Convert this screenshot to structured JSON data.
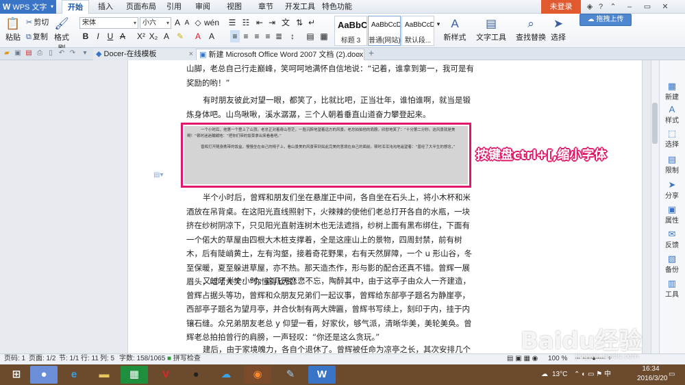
{
  "app": {
    "name": "WPS 文字",
    "menu_tabs": [
      "开始",
      "插入",
      "页面布局",
      "引用",
      "审阅",
      "视图",
      "章节",
      "开发工具",
      "特色功能"
    ],
    "active_tab": "开始",
    "login": "未登录",
    "upload": "拖拽上传"
  },
  "ribbon": {
    "paste": "粘贴",
    "cut": "剪切",
    "copy": "复制",
    "format_painter": "格式刷",
    "font_name": "宋体",
    "font_size": "小六",
    "styles": [
      {
        "sample": "AaBbC",
        "label": "标题 3"
      },
      {
        "sample": "AaBbCcD",
        "label": "普通(网站)"
      },
      {
        "sample": "AaBbCcDd",
        "label": "默认段..."
      }
    ],
    "new_style": "新样式",
    "text_tools": "文字工具",
    "find_replace": "查找替换",
    "select": "选择"
  },
  "tabs": [
    {
      "title": "Docer-在线模板"
    },
    {
      "title": "新建 Microsoft Office Word 2007 文档 (2).docx *"
    }
  ],
  "document": {
    "paragraphs": [
      "山脚，老总自己行走巅峰，笑呵呵地满怀自信地说：“记着，谁拿到第一，我可是有奖励的哟！”",
      "有时朋友彼此对望一眼，都笑了，比就比吧，正当壮年，谁怕谁啊，就当是锻炼身体吧。山鸟啾啾，溪水潺潺，三个人朝着垂直山道奋力攀登起来。",
      "半个小时后，曾辉和朋友们坐在悬崖正中间，各自坐在石头上，将小木杯和米酒放在吊背桌。在这阳光直线照射下，火辣辣的使他们老总打开各自的水瓶，一块挤在纱树阴凉下，只见阳光直射连树木也无法遮挡，纱树上面有黑布绑住，下面有一个偌大的草屋由四根大木桩支撑着，全是这座山上的景物，四周封禁，前有树木，后有陡峭黄土，左有沟壑，接着奇花野果，右有天然屏障，一个 u 形山谷，冬至保暖，夏至躲进草屋，亦不热。那天造杰作，形与影的配合还真不错。曾辉一展眉头，哈哈大笑：“你懂得欣赏！”",
      "又过了半个小时，这几天恋恋不忘，陶醉其中，由于这亭子由众人一齐建造，曾辉占据头等功，曾辉和众朋友兄弟们一起议事，曾辉给东部亭子题名为静崖亭，西部亭子题名为望月亭，并合伙制有两大牌匾，曾辉书写续上，刻印于内，挂于内镶石缝。众兄弟朋友老总 y 仰望一看，好家伙，够气派，清晰华美，美轮美奂。曾辉老总拍拍曾行的肩膀，一声轻叹：“你还是这么贪玩。”",
      "建后，由于家境魄力，各自个退休了。曾辉被任命为凉亭之长，其次安排几个副手。其"
    ],
    "selected_paragraphs": [
      "一个小时后，他第一个登上了山顶。老总正对着奇山苍茫，一脸沉醉地望着远方的风景。老总拍拍他的肩膀，欣慰地笑了：“十分第二分秒。这风景就是美啊！”顿时迷迷糊糊地：“把你们带的饭菜拿出来看看吧。”",
      "曾辉打开随身携带的饭盒，慢慢坐在自己的椅子上，看山景美的风景带到如此完美的意境在自己的面前。顿时浑浑沌沌地遥望着：“曾经了大半生的想念，”"
    ],
    "annotation": "按键盘ctrl+[,缩小字体"
  },
  "right_panel": [
    "新建",
    "样式",
    "选择",
    "限制",
    "分享",
    "属性",
    "反馈",
    "备份",
    "工具"
  ],
  "status": {
    "page_num": "页码: 1",
    "pages": "页面: 1/2",
    "section": "节: 1/1",
    "row": "行: 11",
    "col": "列: 5",
    "chars": "字数: 158/1065",
    "spell": "拼写检查",
    "zoom": "100 %"
  },
  "taskbar": {
    "temperature": "13°C",
    "time": "16:34",
    "date": "2016/3/20"
  },
  "watermark": {
    "brand": "Baidu经验",
    "url": "jingyan.baidu.com"
  }
}
